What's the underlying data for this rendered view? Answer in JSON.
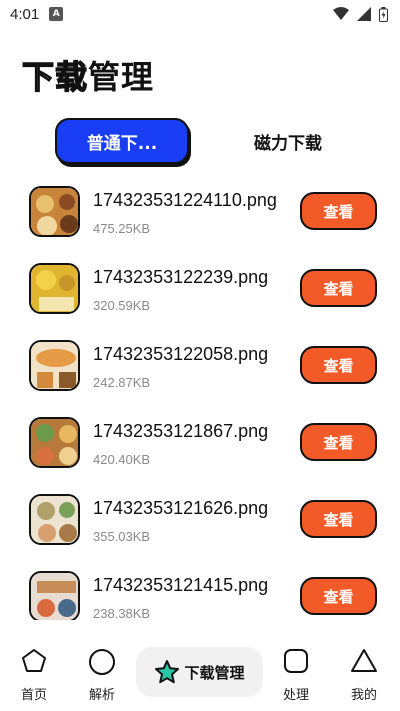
{
  "status_bar": {
    "time": "4:01",
    "notification_icon": "A"
  },
  "header": {
    "title_outlined": "下载",
    "title_solid": "管理"
  },
  "tabs": [
    {
      "label": "普通下...",
      "active": true
    },
    {
      "label": "磁力下载",
      "active": false
    }
  ],
  "files": [
    {
      "name": "174323531224110.png",
      "size": "475.25KB",
      "thumb_color": "#c8843a",
      "action": "查看"
    },
    {
      "name": "17432353122239.png",
      "size": "320.59KB",
      "thumb_color": "#e0b530",
      "action": "查看"
    },
    {
      "name": "17432353122058.png",
      "size": "242.87KB",
      "thumb_color": "#e59a46",
      "action": "查看"
    },
    {
      "name": "17432353121867.png",
      "size": "420.40KB",
      "thumb_color": "#b77a3a",
      "action": "查看"
    },
    {
      "name": "17432353121626.png",
      "size": "355.03KB",
      "thumb_color": "#b2a06a",
      "action": "查看"
    },
    {
      "name": "17432353121415.png",
      "size": "238.38KB",
      "thumb_color": "#c78e5a",
      "action": "查看"
    }
  ],
  "nav": {
    "home": "首页",
    "parse": "解析",
    "downloads": "下载管理",
    "process": "处理",
    "mine": "我的"
  },
  "colors": {
    "accent_blue": "#1a3ef5",
    "button_orange": "#f25a28",
    "star_teal": "#2ec4a6"
  }
}
